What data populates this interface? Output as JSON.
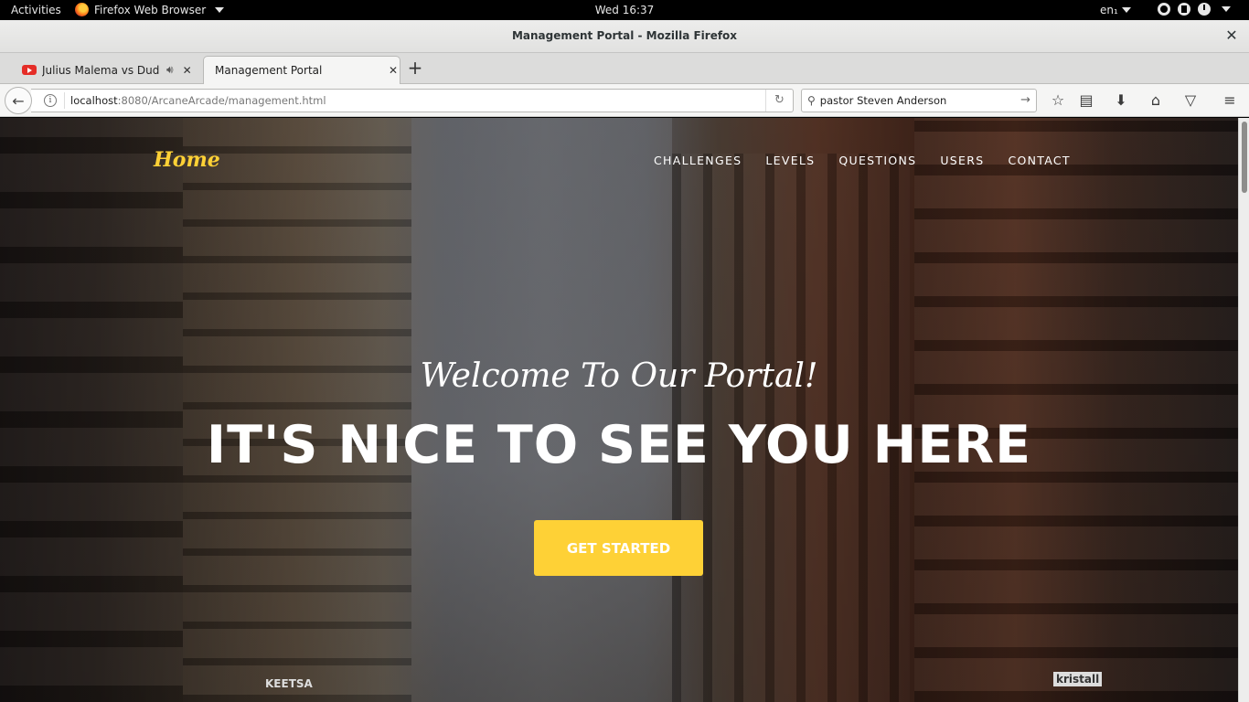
{
  "system_bar": {
    "activities": "Activities",
    "app_name": "Firefox Web Browser",
    "clock": "Wed 16:37",
    "language": "en₁"
  },
  "window": {
    "title": "Management Portal - Mozilla Firefox",
    "close": "✕"
  },
  "tabs": [
    {
      "label": "Julius Malema vs Dudu ...",
      "icon": "youtube-icon",
      "audio": true,
      "active": false
    },
    {
      "label": "Management Portal",
      "active": true
    }
  ],
  "tab_close_glyph": "✕",
  "new_tab_glyph": "+",
  "navbar": {
    "url_host": "localhost",
    "url_path": ":8080/ArcaneArcade/management.html",
    "search_value": "pastor Steven Anderson"
  },
  "page": {
    "brand": "Home",
    "nav": [
      "CHALLENGES",
      "LEVELS",
      "QUESTIONS",
      "USERS",
      "CONTACT"
    ],
    "hero_subtitle": "Welcome To Our Portal!",
    "hero_title": "IT'S NICE TO SEE YOU HERE",
    "cta": "GET STARTED",
    "sign_keetsa": "KEETSA",
    "sign_kristall": "kristall"
  },
  "colors": {
    "accent": "#fed136",
    "topbar": "#000000"
  }
}
